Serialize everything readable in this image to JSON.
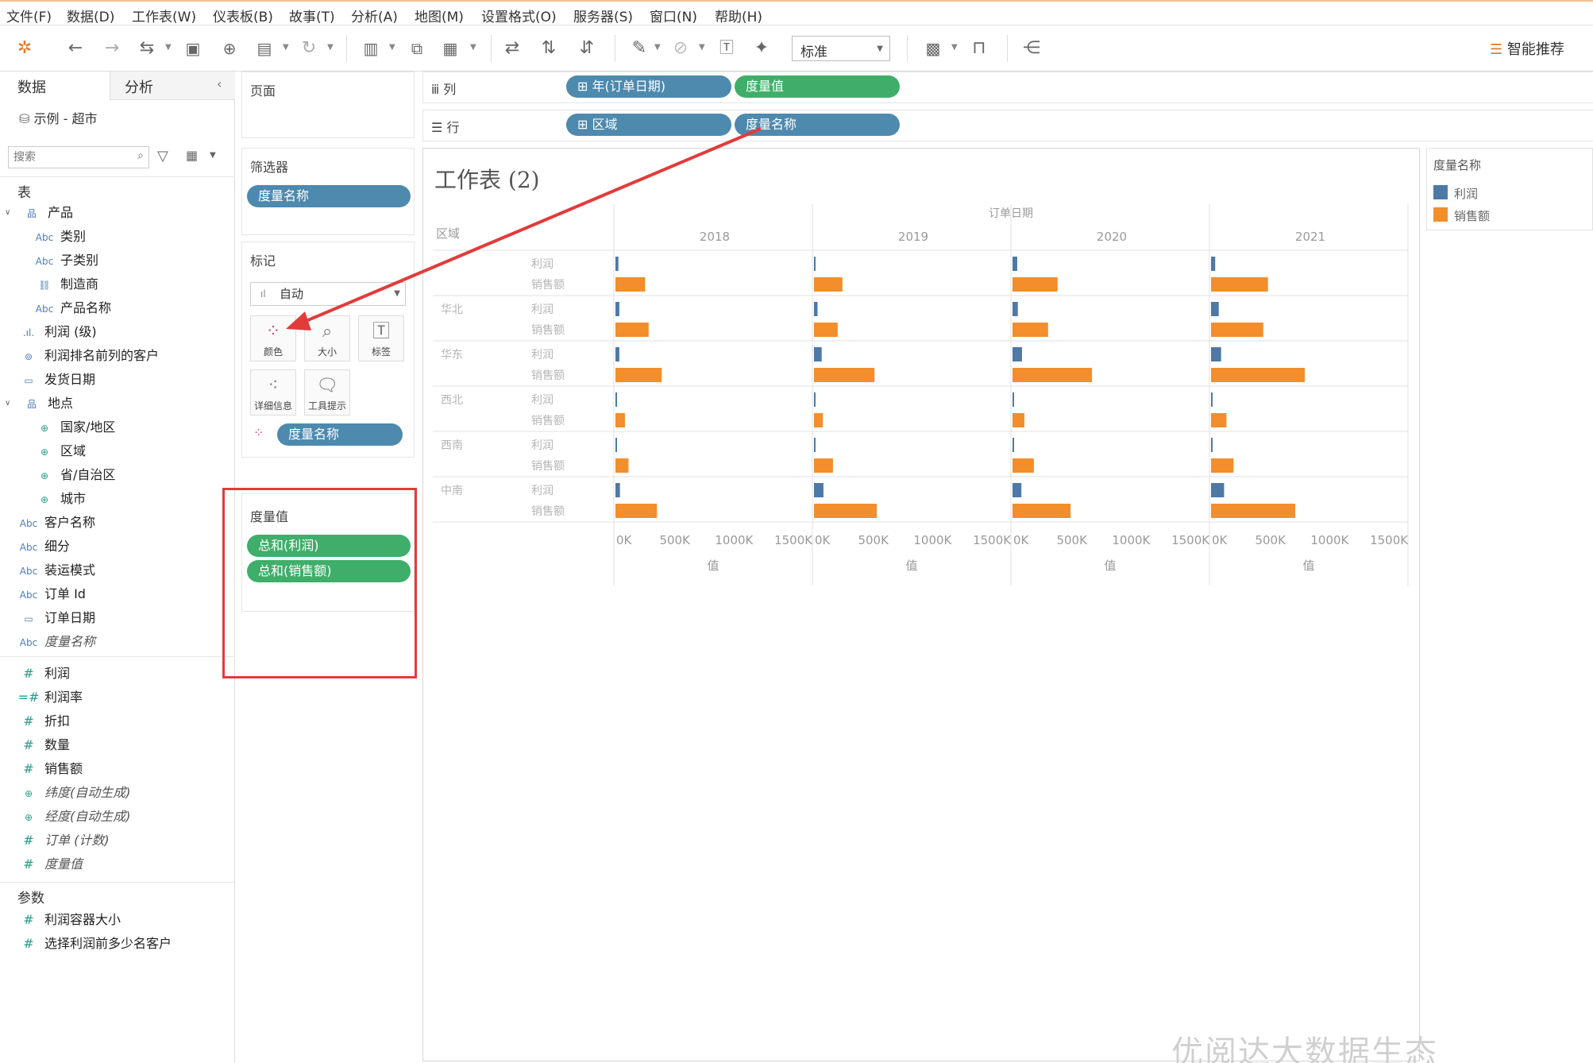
{
  "menu": [
    "文件(F)",
    "数据(D)",
    "工作表(W)",
    "仪表板(B)",
    "故事(T)",
    "分析(A)",
    "地图(M)",
    "设置格式(O)",
    "服务器(S)",
    "窗口(N)",
    "帮助(H)"
  ],
  "toolbar": {
    "fit_value": "标准",
    "smart_recommend": "智能推荐"
  },
  "data_pane": {
    "tabs": [
      "数据",
      "分析"
    ],
    "datasource": "示例 - 超市",
    "search_placeholder": "搜索",
    "tables_label": "表",
    "params_label": "参数",
    "fields": [
      {
        "label": "产品",
        "icon": "hierarchy-icon"
      },
      {
        "label": "类别",
        "icon": "Abc"
      },
      {
        "label": "子类别",
        "icon": "Abc"
      },
      {
        "label": "制造商",
        "icon": "link-icon"
      },
      {
        "label": "产品名称",
        "icon": "Abc"
      },
      {
        "label": "利润 (级)",
        "icon": "bin-icon"
      },
      {
        "label": "利润排名前列的客户",
        "icon": "set-icon"
      },
      {
        "label": "发货日期",
        "icon": "calendar-icon"
      },
      {
        "label": "地点",
        "icon": "hierarchy-icon"
      },
      {
        "label": "国家/地区",
        "icon": "globe-icon"
      },
      {
        "label": "区域",
        "icon": "globe-icon"
      },
      {
        "label": "省/自治区",
        "icon": "globe-icon"
      },
      {
        "label": "城市",
        "icon": "globe-icon"
      },
      {
        "label": "客户名称",
        "icon": "Abc"
      },
      {
        "label": "细分",
        "icon": "Abc"
      },
      {
        "label": "装运模式",
        "icon": "Abc"
      },
      {
        "label": "订单 Id",
        "icon": "Abc"
      },
      {
        "label": "订单日期",
        "icon": "calendar-icon"
      },
      {
        "label": "度量名称",
        "icon": "Abc"
      },
      {
        "label": "利润",
        "icon": "#"
      },
      {
        "label": "利润率",
        "icon": "=#"
      },
      {
        "label": "折扣",
        "icon": "#"
      },
      {
        "label": "数量",
        "icon": "#"
      },
      {
        "label": "销售额",
        "icon": "#"
      },
      {
        "label": "纬度(自动生成)",
        "icon": "globe-icon"
      },
      {
        "label": "经度(自动生成)",
        "icon": "globe-icon"
      },
      {
        "label": "订单 (计数)",
        "icon": "#"
      },
      {
        "label": "度量值",
        "icon": "#"
      }
    ],
    "params": [
      {
        "label": "利润容器大小",
        "icon": "#"
      },
      {
        "label": "选择利润前多少名客户",
        "icon": "#"
      }
    ]
  },
  "shelves": {
    "pages": "页面",
    "filters": "筛选器",
    "filter_pill": "度量名称",
    "marks": "标记",
    "mark_type": "自动",
    "mark_buttons": [
      "颜色",
      "大小",
      "标签",
      "详细信息",
      "工具提示"
    ],
    "color_pill": "度量名称",
    "measure_values": "度量值",
    "measure_pills": [
      "总和(利润)",
      "总和(销售额)"
    ],
    "columns_label": "列",
    "rows_label": "行",
    "columns_pills": [
      "年(订单日期)",
      "度量值"
    ],
    "rows_pills": [
      "区域",
      "度量名称"
    ]
  },
  "sheet": {
    "title": "工作表 (2)",
    "legend_title": "度量名称",
    "legend_items": [
      "利润",
      "销售额"
    ]
  },
  "colors": {
    "profit": "#4e79a7",
    "sales": "#f28e2b",
    "pill_blue": "#4e89ae",
    "pill_green": "#3fae6a",
    "highlight": "#e23b3b"
  },
  "chart_data": {
    "type": "bar",
    "column_header": "订单日期",
    "row_header": "区域",
    "years": [
      "2018",
      "2019",
      "2020",
      "2021"
    ],
    "regions": [
      "",
      "华北",
      "华东",
      "西北",
      "西南",
      "中南"
    ],
    "measures": [
      "利润",
      "销售额"
    ],
    "x_ticks": [
      "0K",
      "500K",
      "1000K",
      "1500K"
    ],
    "xlabel": "值",
    "xlim": [
      0,
      1620000
    ],
    "values": {
      "2018": {
        "profit": [
          25000,
          33000,
          33000,
          7000,
          3000,
          38000
        ],
        "sales": [
          250000,
          280000,
          390000,
          80000,
          110000,
          350000
        ]
      },
      "2019": {
        "profit": [
          10000,
          30000,
          65000,
          7000,
          2000,
          80000
        ],
        "sales": [
          240000,
          200000,
          510000,
          75000,
          160000,
          530000
        ]
      },
      "2020": {
        "profit": [
          40000,
          45000,
          80000,
          12000,
          10000,
          75000
        ],
        "sales": [
          380000,
          300000,
          670000,
          100000,
          180000,
          490000
        ]
      },
      "2021": {
        "profit": [
          35000,
          65000,
          85000,
          8000,
          12000,
          110000
        ],
        "sales": [
          480000,
          440000,
          790000,
          130000,
          190000,
          710000
        ]
      }
    }
  },
  "watermark": "优阅达大数据生态"
}
